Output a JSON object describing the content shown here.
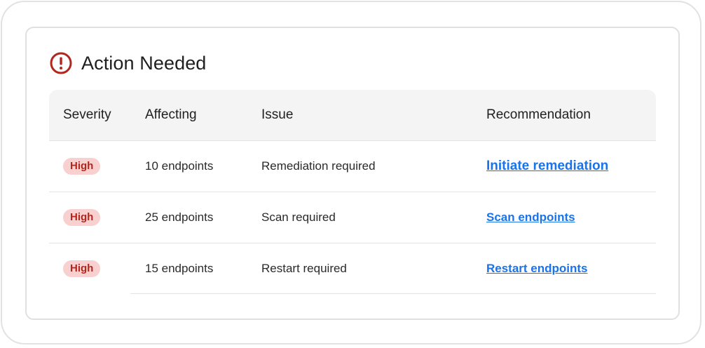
{
  "panel": {
    "title": "Action Needed",
    "icon": "alert-circle-icon",
    "accent_color": "#b3261e"
  },
  "table": {
    "columns": [
      "Severity",
      "Affecting",
      "Issue",
      "Recommendation"
    ],
    "rows": [
      {
        "severity": "High",
        "affecting": "10 endpoints",
        "issue": "Remediation required",
        "recommendation": "Initiate remediation"
      },
      {
        "severity": "High",
        "affecting": "25 endpoints",
        "issue": "Scan required",
        "recommendation": "Scan endpoints"
      },
      {
        "severity": "High",
        "affecting": "15 endpoints",
        "issue": "Restart required",
        "recommendation": "Restart endpoints"
      }
    ]
  },
  "colors": {
    "badge_bg": "#f8d0cf",
    "badge_text": "#b3261e",
    "link": "#1a73e8",
    "header_bg": "#f3f4f3"
  }
}
